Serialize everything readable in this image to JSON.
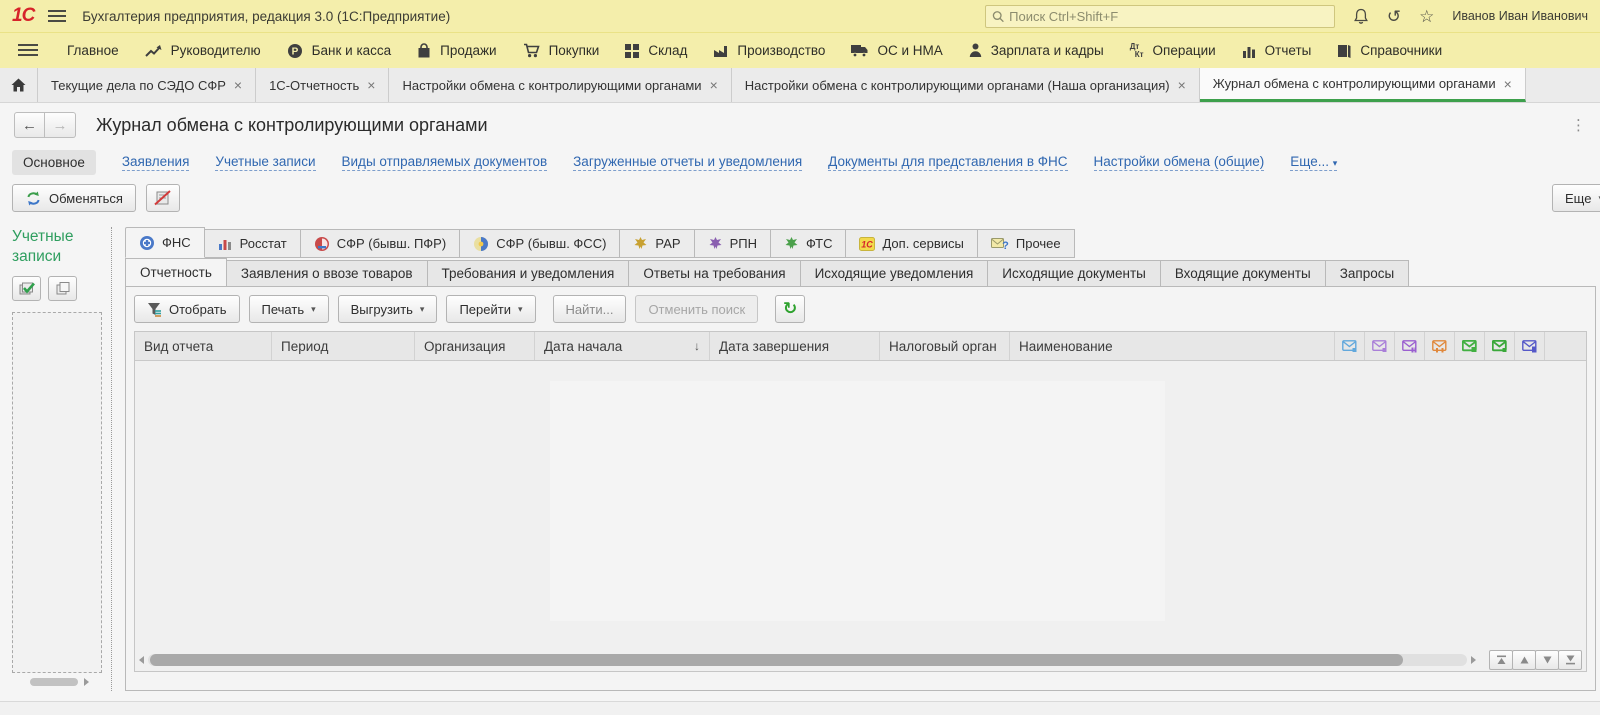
{
  "window": {
    "logo": "1С",
    "app_title": "Бухгалтерия предприятия, редакция 3.0  (1С:Предприятие)",
    "search_placeholder": "Поиск Ctrl+Shift+F",
    "user": "Иванов Иван Иванович"
  },
  "icons": {
    "close": "×",
    "dropdown": "▾",
    "sort_desc": "↓",
    "refresh": "↻",
    "back": "←",
    "forward": "→",
    "star": "☆",
    "history": "↺",
    "kebab": "⋮",
    "dt": "Дт",
    "kt": "Кт",
    "question": "?",
    "logo_small": "1С"
  },
  "menu": {
    "items": [
      {
        "label": "Главное"
      },
      {
        "label": "Руководителю"
      },
      {
        "label": "Банк и касса"
      },
      {
        "label": "Продажи"
      },
      {
        "label": "Покупки"
      },
      {
        "label": "Склад"
      },
      {
        "label": "Производство"
      },
      {
        "label": "ОС и НМА"
      },
      {
        "label": "Зарплата и кадры"
      },
      {
        "label": "Операции"
      },
      {
        "label": "Отчеты"
      },
      {
        "label": "Справочники"
      }
    ]
  },
  "tabs": {
    "items": [
      {
        "label": "Текущие дела по СЭДО СФР"
      },
      {
        "label": "1С-Отчетность"
      },
      {
        "label": "Настройки обмена с контролирующими органами"
      },
      {
        "label": "Настройки обмена с контролирующими органами (Наша организация)"
      },
      {
        "label": "Журнал обмена с контролирующими органами"
      }
    ],
    "active_index": 4
  },
  "page": {
    "title": "Журнал обмена с контролирующими органами"
  },
  "navlinks": {
    "active": "Основное",
    "links": [
      "Заявления",
      "Учетные записи",
      "Виды отправляемых документов",
      "Загруженные отчеты и уведомления",
      "Документы для представления в ФНС",
      "Настройки обмена (общие)"
    ],
    "more": "Еще..."
  },
  "commands": {
    "exchange": "Обменяться",
    "more": "Еще"
  },
  "sidebar": {
    "title": "Учетные записи"
  },
  "agencies": {
    "items": [
      {
        "label": "ФНС",
        "active": true
      },
      {
        "label": "Росстат"
      },
      {
        "label": "СФР (бывш. ПФР)"
      },
      {
        "label": "СФР (бывш. ФСС)"
      },
      {
        "label": "РАР"
      },
      {
        "label": "РПН"
      },
      {
        "label": "ФТС"
      },
      {
        "label": "Доп. сервисы"
      },
      {
        "label": "Прочее"
      }
    ]
  },
  "doc_tabs": {
    "items": [
      {
        "label": "Отчетность",
        "active": true
      },
      {
        "label": "Заявления о ввозе товаров"
      },
      {
        "label": "Требования и уведомления"
      },
      {
        "label": "Ответы на требования"
      },
      {
        "label": "Исходящие уведомления"
      },
      {
        "label": "Исходящие документы"
      },
      {
        "label": "Входящие документы"
      },
      {
        "label": "Запросы"
      }
    ]
  },
  "toolbar": {
    "select": "Отобрать",
    "print": "Печать",
    "export": "Выгрузить",
    "goto": "Перейти",
    "find": "Найти...",
    "cancel_search": "Отменить поиск"
  },
  "table": {
    "columns": [
      {
        "label": "Вид отчета"
      },
      {
        "label": "Период"
      },
      {
        "label": "Организация"
      },
      {
        "label": "Дата начала",
        "sorted": "desc"
      },
      {
        "label": "Дата завершения"
      },
      {
        "label": "Налоговый орган"
      },
      {
        "label": "Наименование"
      }
    ],
    "icon_columns": [
      {
        "name": "envelope-status-blue",
        "color": "#62a8dc"
      },
      {
        "name": "envelope-status-violet",
        "color": "#a97fd8"
      },
      {
        "name": "envelope-status-purple",
        "color": "#9a5fd0"
      },
      {
        "name": "envelope-status-orange",
        "color": "#e0883c"
      },
      {
        "name": "envelope-status-green-filled",
        "color": "#42b042"
      },
      {
        "name": "envelope-status-green",
        "color": "#3aa83a"
      },
      {
        "name": "envelope-status-indigo",
        "color": "#5558c8"
      }
    ],
    "rows": []
  },
  "colors": {
    "accent_green": "#2f9e5f",
    "link_blue": "#3067b0",
    "bar_yellow": "#f4eeab",
    "active_tab_underline": "#3da04c"
  }
}
